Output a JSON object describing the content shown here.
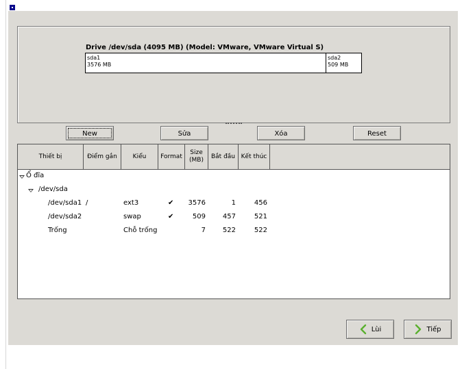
{
  "drive": {
    "title": "Drive /dev/sda (4095 MB) (Model: VMware, VMware Virtual S)",
    "segments": [
      {
        "name": "sda1",
        "size": "3576 MB"
      },
      {
        "name": "sda2",
        "size": "509 MB"
      }
    ]
  },
  "buttons": {
    "new": "New",
    "edit": "Sửa",
    "delete": "Xóa",
    "reset": "Reset"
  },
  "table": {
    "headers": {
      "device": "Thiết bị",
      "mount": "Điểm gắn",
      "type": "Kiểu",
      "format": "Format",
      "size": "Size (MB)",
      "start": "Bắt đầu",
      "end": "Kết thúc"
    },
    "tree_root": "Ổ đĩa",
    "tree_disk": "/dev/sda",
    "rows": [
      {
        "device": "/dev/sda1",
        "mount": "/",
        "type": "ext3",
        "format": "✔",
        "size": "3576",
        "start": "1",
        "end": "456"
      },
      {
        "device": "/dev/sda2",
        "mount": "",
        "type": "swap",
        "format": "✔",
        "size": "509",
        "start": "457",
        "end": "521"
      },
      {
        "device": "Trống",
        "mount": "",
        "type": "Chỗ trống",
        "format": "",
        "size": "7",
        "start": "522",
        "end": "522"
      }
    ]
  },
  "nav": {
    "back": "Lùi",
    "next": "Tiếp",
    "accent": "#5ab02e"
  }
}
